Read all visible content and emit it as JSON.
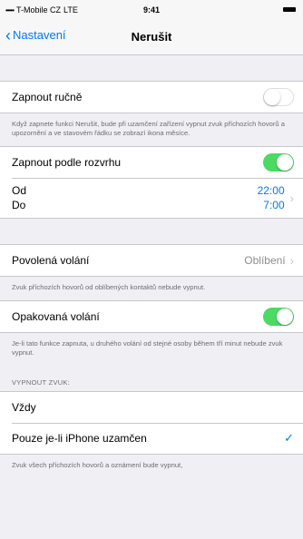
{
  "status_bar": {
    "carrier": "T-Mobile CZ",
    "network": "LTE",
    "time": "9:41",
    "signal": "•••••"
  },
  "nav": {
    "back_label": "Nastavení",
    "title": "Nerušit"
  },
  "manual": {
    "label": "Zapnout ručně",
    "toggle_on": false,
    "footer": "Když zapnete funkci Nerušit, bude při uzamčení zařízení vypnut zvuk příchozích hovorů a upozornění a ve stavovém řádku se zobrazí ikona měsíce."
  },
  "scheduled": {
    "label": "Zapnout podle rozvrhu",
    "toggle_on": true,
    "from_label": "Od",
    "to_label": "Do",
    "from_time": "22:00",
    "to_time": "7:00"
  },
  "allow_calls": {
    "label": "Povolená volání",
    "value": "Oblíbení",
    "footer": "Zvuk příchozích hovorů od oblíbených kontaktů nebude vypnut."
  },
  "repeated_calls": {
    "label": "Opakovaná volání",
    "toggle_on": true,
    "footer": "Je-li tato funkce zapnuta, u druhého volání od stejné osoby během tří minut nebude zvuk vypnut."
  },
  "silence": {
    "header": "VYPNOUT ZVUK:",
    "options": [
      {
        "label": "Vždy",
        "selected": false
      },
      {
        "label": "Pouze je-li iPhone uzamčen",
        "selected": true
      }
    ],
    "footer": "Zvuk všech příchozích hovorů a oznámení bude vypnut,"
  },
  "colors": {
    "accent": "#007aff",
    "toggle_on": "#4cd964",
    "brand_mark": "#e4007a"
  }
}
